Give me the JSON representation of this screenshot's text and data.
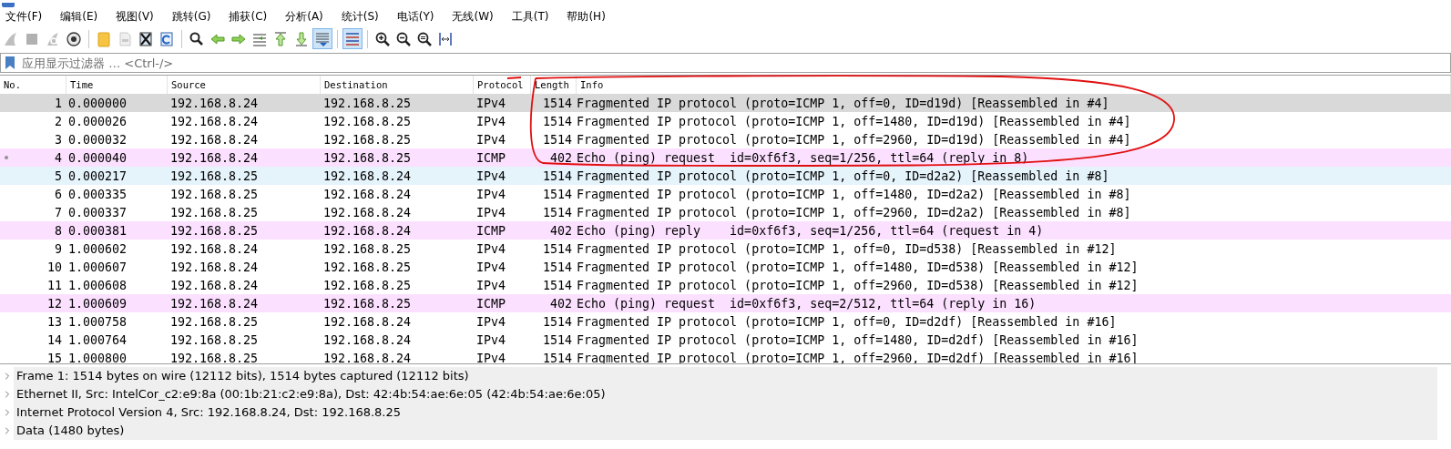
{
  "menu": [
    "文件(F)",
    "编辑(E)",
    "视图(V)",
    "跳转(G)",
    "捕获(C)",
    "分析(A)",
    "统计(S)",
    "电话(Y)",
    "无线(W)",
    "工具(T)",
    "帮助(H)"
  ],
  "toolbar": [
    [
      {
        "kind": "shark-fin",
        "disabled": true,
        "pressed": false
      },
      {
        "kind": "stop",
        "disabled": true,
        "pressed": false
      },
      {
        "kind": "restart",
        "disabled": true,
        "pressed": false
      },
      {
        "kind": "options",
        "disabled": false,
        "pressed": false
      }
    ],
    [
      {
        "kind": "open",
        "disabled": false,
        "pressed": false
      },
      {
        "kind": "save",
        "disabled": true,
        "pressed": false
      },
      {
        "kind": "close",
        "disabled": false,
        "pressed": false
      },
      {
        "kind": "reload",
        "disabled": false,
        "pressed": false
      }
    ],
    [
      {
        "kind": "find",
        "disabled": false,
        "pressed": false
      },
      {
        "kind": "back",
        "disabled": false,
        "pressed": false
      },
      {
        "kind": "forward",
        "disabled": false,
        "pressed": false
      },
      {
        "kind": "goto",
        "disabled": false,
        "pressed": false
      },
      {
        "kind": "first",
        "disabled": false,
        "pressed": false
      },
      {
        "kind": "last",
        "disabled": false,
        "pressed": false
      },
      {
        "kind": "autoscroll",
        "disabled": false,
        "pressed": true
      }
    ],
    [
      {
        "kind": "colorize",
        "disabled": false,
        "pressed": true
      }
    ],
    [
      {
        "kind": "zoom-in",
        "disabled": false,
        "pressed": false
      },
      {
        "kind": "zoom-out",
        "disabled": false,
        "pressed": false
      },
      {
        "kind": "zoom-reset",
        "disabled": false,
        "pressed": false
      },
      {
        "kind": "resize-columns",
        "disabled": false,
        "pressed": false
      }
    ]
  ],
  "filter": {
    "placeholder": "应用显示过滤器 … <Ctrl-/>"
  },
  "table": {
    "columns": [
      "No.",
      "Time",
      "Source",
      "Destination",
      "Protocol",
      "Length",
      "Info"
    ],
    "rows": [
      {
        "no": "1",
        "time": "0.000000",
        "source": "192.168.8.24",
        "destination": "192.168.8.25",
        "protocol": "IPv4",
        "length": "1514",
        "info": "Fragmented IP protocol (proto=ICMP 1, off=0, ID=d19d) [Reassembled in #4]",
        "kind": "ipv4",
        "selected": true,
        "hovered": false,
        "related": false
      },
      {
        "no": "2",
        "time": "0.000026",
        "source": "192.168.8.24",
        "destination": "192.168.8.25",
        "protocol": "IPv4",
        "length": "1514",
        "info": "Fragmented IP protocol (proto=ICMP 1, off=1480, ID=d19d) [Reassembled in #4]",
        "kind": "ipv4",
        "selected": false,
        "hovered": false,
        "related": false
      },
      {
        "no": "3",
        "time": "0.000032",
        "source": "192.168.8.24",
        "destination": "192.168.8.25",
        "protocol": "IPv4",
        "length": "1514",
        "info": "Fragmented IP protocol (proto=ICMP 1, off=2960, ID=d19d) [Reassembled in #4]",
        "kind": "ipv4",
        "selected": false,
        "hovered": false,
        "related": false
      },
      {
        "no": "4",
        "time": "0.000040",
        "source": "192.168.8.24",
        "destination": "192.168.8.25",
        "protocol": "ICMP",
        "length": "402",
        "info": "Echo (ping) request  id=0xf6f3, seq=1/256, ttl=64 (reply in 8)",
        "kind": "icmp",
        "selected": false,
        "hovered": false,
        "related": true
      },
      {
        "no": "5",
        "time": "0.000217",
        "source": "192.168.8.25",
        "destination": "192.168.8.24",
        "protocol": "IPv4",
        "length": "1514",
        "info": "Fragmented IP protocol (proto=ICMP 1, off=0, ID=d2a2) [Reassembled in #8]",
        "kind": "ipv4",
        "selected": false,
        "hovered": true,
        "related": false
      },
      {
        "no": "6",
        "time": "0.000335",
        "source": "192.168.8.25",
        "destination": "192.168.8.24",
        "protocol": "IPv4",
        "length": "1514",
        "info": "Fragmented IP protocol (proto=ICMP 1, off=1480, ID=d2a2) [Reassembled in #8]",
        "kind": "ipv4",
        "selected": false,
        "hovered": false,
        "related": false
      },
      {
        "no": "7",
        "time": "0.000337",
        "source": "192.168.8.25",
        "destination": "192.168.8.24",
        "protocol": "IPv4",
        "length": "1514",
        "info": "Fragmented IP protocol (proto=ICMP 1, off=2960, ID=d2a2) [Reassembled in #8]",
        "kind": "ipv4",
        "selected": false,
        "hovered": false,
        "related": false
      },
      {
        "no": "8",
        "time": "0.000381",
        "source": "192.168.8.25",
        "destination": "192.168.8.24",
        "protocol": "ICMP",
        "length": "402",
        "info": "Echo (ping) reply    id=0xf6f3, seq=1/256, ttl=64 (request in 4)",
        "kind": "icmp",
        "selected": false,
        "hovered": false,
        "related": false
      },
      {
        "no": "9",
        "time": "1.000602",
        "source": "192.168.8.24",
        "destination": "192.168.8.25",
        "protocol": "IPv4",
        "length": "1514",
        "info": "Fragmented IP protocol (proto=ICMP 1, off=0, ID=d538) [Reassembled in #12]",
        "kind": "ipv4",
        "selected": false,
        "hovered": false,
        "related": false
      },
      {
        "no": "10",
        "time": "1.000607",
        "source": "192.168.8.24",
        "destination": "192.168.8.25",
        "protocol": "IPv4",
        "length": "1514",
        "info": "Fragmented IP protocol (proto=ICMP 1, off=1480, ID=d538) [Reassembled in #12]",
        "kind": "ipv4",
        "selected": false,
        "hovered": false,
        "related": false
      },
      {
        "no": "11",
        "time": "1.000608",
        "source": "192.168.8.24",
        "destination": "192.168.8.25",
        "protocol": "IPv4",
        "length": "1514",
        "info": "Fragmented IP protocol (proto=ICMP 1, off=2960, ID=d538) [Reassembled in #12]",
        "kind": "ipv4",
        "selected": false,
        "hovered": false,
        "related": false
      },
      {
        "no": "12",
        "time": "1.000609",
        "source": "192.168.8.24",
        "destination": "192.168.8.25",
        "protocol": "ICMP",
        "length": "402",
        "info": "Echo (ping) request  id=0xf6f3, seq=2/512, ttl=64 (reply in 16)",
        "kind": "icmp",
        "selected": false,
        "hovered": false,
        "related": false
      },
      {
        "no": "13",
        "time": "1.000758",
        "source": "192.168.8.25",
        "destination": "192.168.8.24",
        "protocol": "IPv4",
        "length": "1514",
        "info": "Fragmented IP protocol (proto=ICMP 1, off=0, ID=d2df) [Reassembled in #16]",
        "kind": "ipv4",
        "selected": false,
        "hovered": false,
        "related": false
      },
      {
        "no": "14",
        "time": "1.000764",
        "source": "192.168.8.25",
        "destination": "192.168.8.24",
        "protocol": "IPv4",
        "length": "1514",
        "info": "Fragmented IP protocol (proto=ICMP 1, off=1480, ID=d2df) [Reassembled in #16]",
        "kind": "ipv4",
        "selected": false,
        "hovered": false,
        "related": false
      },
      {
        "no": "15",
        "time": "1.000800",
        "source": "192.168.8.25",
        "destination": "192.168.8.24",
        "protocol": "IPv4",
        "length": "1514",
        "info": "Fragmented IP protocol (proto=ICMP 1, off=2960, ID=d2df) [Reassembled in #16]",
        "kind": "ipv4",
        "selected": false,
        "hovered": false,
        "related": false
      }
    ]
  },
  "details": [
    {
      "text": "Frame 1: 1514 bytes on wire (12112 bits), 1514 bytes captured (12112 bits)",
      "expanded": false
    },
    {
      "text": "Ethernet II, Src: IntelCor_c2:e9:8a (00:1b:21:c2:e9:8a), Dst: 42:4b:54:ae:6e:05 (42:4b:54:ae:6e:05)",
      "expanded": false
    },
    {
      "text": "Internet Protocol Version 4, Src: 192.168.8.24, Dst: 192.168.8.25",
      "expanded": false
    },
    {
      "text": "Data (1480 bytes)",
      "expanded": false
    }
  ]
}
